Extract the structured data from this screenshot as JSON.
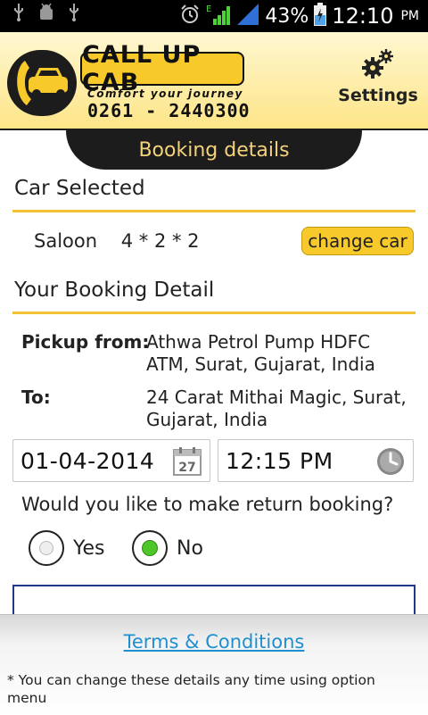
{
  "status_bar": {
    "battery_percent": "43%",
    "time": "12:10",
    "ampm": "PM",
    "left_icons": [
      "usb-icon",
      "android-debug-icon",
      "usb-icon"
    ],
    "right_icons": [
      "alarm-icon",
      "signal-e-icon",
      "signal-icon",
      "battery-charging-icon"
    ]
  },
  "header": {
    "logo_title": "CALL UP CAB",
    "logo_tagline": "Comfort your journey",
    "logo_phone": "0261 - 2440300",
    "settings_label": "Settings",
    "settings_icon": "gears-icon"
  },
  "section_title": "Booking details",
  "car_selected": {
    "heading": "Car Selected",
    "car_name": "Saloon",
    "car_config": "4 * 2 * 2",
    "change_button": "change car"
  },
  "booking_detail": {
    "heading": "Your Booking Detail",
    "pickup_label": "Pickup from:",
    "pickup_value": "Athwa Petrol Pump HDFC ATM, Surat, Gujarat, India",
    "to_label": "To:",
    "to_value": "24 Carat Mithai Magic, Surat, Gujarat, India",
    "date": "01-04-2014",
    "calendar_day": "27",
    "time": "12:15 PM",
    "return_question": "Would you like to make return booking?",
    "options": [
      {
        "label": "Yes",
        "selected": false
      },
      {
        "label": "No",
        "selected": true
      }
    ]
  },
  "footer": {
    "terms_link": "Terms & Conditions",
    "footnote": "* You can change these details any time using option menu"
  },
  "colors": {
    "accent_yellow": "#f7c92a",
    "header_dark": "#1c1c1c",
    "tab_text": "#f4d27a",
    "link_blue": "#1f8fcf",
    "radio_green": "#4cc629"
  }
}
